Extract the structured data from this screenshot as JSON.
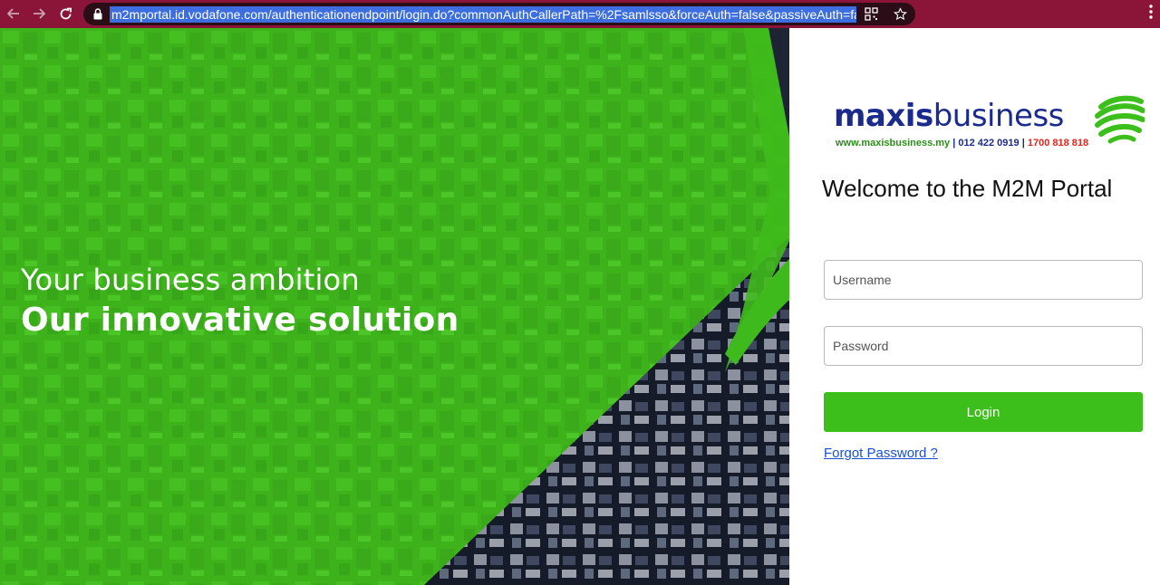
{
  "browser": {
    "url": "m2mportal.id.vodafone.com/authenticationendpoint/login.do?commonAuthCallerPath=%2Fsamlsso&forceAuth=false&passiveAuth=false&te",
    "icons": [
      "back-arrow-icon",
      "forward-arrow-icon",
      "reload-icon",
      "lock-icon",
      "qr-code-icon",
      "star-icon",
      "more-vert-icon"
    ],
    "chrome_color": "#8a1538"
  },
  "hero": {
    "line1": "Your business ambition",
    "line2": "Our innovative solution",
    "accent_color": "#3fba1c"
  },
  "logo": {
    "brand_bold": "maxis",
    "brand_light": "business",
    "website": "www.maxisbusiness.my",
    "separator": "|",
    "phone1": "012 422 0919",
    "phone2": "1700 818 818"
  },
  "login": {
    "title": "Welcome to the M2M Portal",
    "username_placeholder": "Username",
    "password_placeholder": "Password",
    "login_label": "Login",
    "forgot_label": "Forgot Password ?",
    "button_color": "#3cbf1b"
  }
}
